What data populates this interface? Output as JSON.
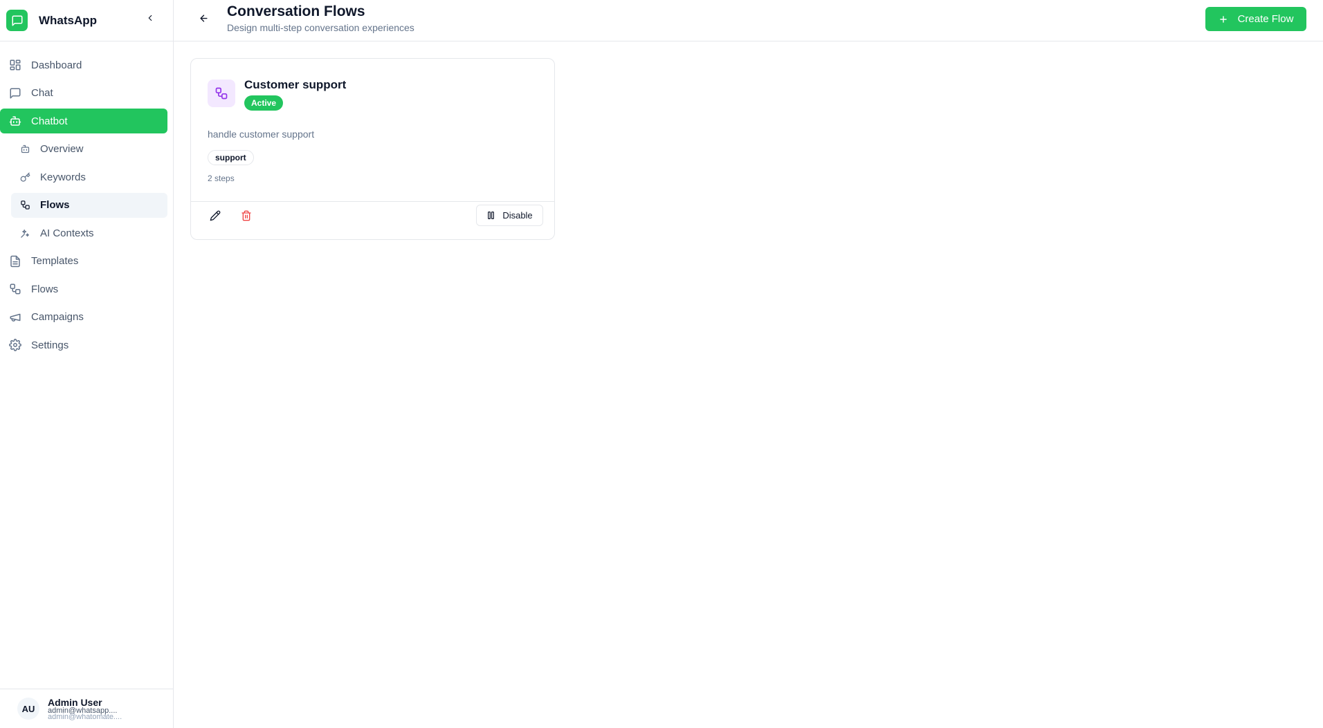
{
  "sidebar": {
    "brand": {
      "name": "WhatsApp",
      "logo_icon": "message-square-icon",
      "accent": "#22c55e"
    },
    "items": [
      {
        "label": "Dashboard",
        "icon": "layout-dashboard-icon"
      },
      {
        "label": "Chat",
        "icon": "message-square-icon"
      },
      {
        "label": "Chatbot",
        "icon": "bot-icon",
        "active": true
      },
      {
        "label": "Templates",
        "icon": "file-text-icon"
      },
      {
        "label": "Flows",
        "icon": "workflow-icon"
      },
      {
        "label": "Campaigns",
        "icon": "megaphone-icon"
      },
      {
        "label": "Settings",
        "icon": "settings-icon"
      }
    ],
    "chatbot_sub": [
      {
        "label": "Overview",
        "icon": "bot-icon"
      },
      {
        "label": "Keywords",
        "icon": "key-icon"
      },
      {
        "label": "Flows",
        "icon": "workflow-icon",
        "selected": true
      },
      {
        "label": "AI Contexts",
        "icon": "sparkles-icon"
      }
    ],
    "user": {
      "initials": "AU",
      "name": "Admin User",
      "email": "admin@whatsapp....",
      "email_secondary": "admin@whatomate...."
    }
  },
  "header": {
    "title": "Conversation Flows",
    "subtitle": "Design multi-step conversation experiences",
    "create_label": "Create Flow"
  },
  "flows": [
    {
      "title": "Customer support",
      "status": "Active",
      "description": "handle customer support",
      "tags": [
        "support"
      ],
      "steps": "2 steps",
      "disable_label": "Disable"
    }
  ],
  "colors": {
    "primary": "#22c55e",
    "danger": "#ef4444",
    "flow_icon_bg": "#f3e8ff",
    "flow_icon": "#9333ea"
  }
}
